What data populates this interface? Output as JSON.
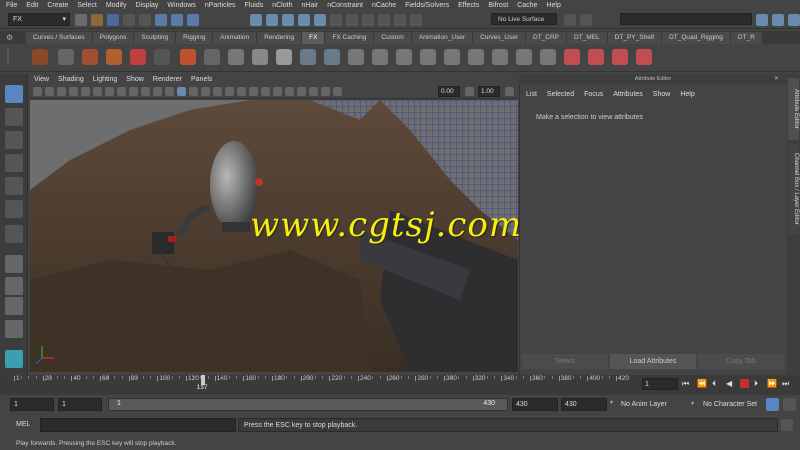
{
  "menubar": [
    "File",
    "Edit",
    "Create",
    "Select",
    "Modify",
    "Display",
    "Windows",
    "nParticles",
    "Fluids",
    "nCloth",
    "nHair",
    "nConstraint",
    "nCache",
    "Fields/Solvers",
    "Effects",
    "Bifrost",
    "Cache",
    "Help"
  ],
  "statusline": {
    "mode": "FX",
    "live_surface": "No Live Surface"
  },
  "shelf_tabs": [
    "Curves / Surfaces",
    "Polygons",
    "Sculpting",
    "Rigging",
    "Animation",
    "Rendering",
    "FX",
    "FX Caching",
    "Custom",
    "Animation_User",
    "Curves_User",
    "DT_CRP",
    "DT_MEL",
    "DT_PY_Shelf",
    "DT_Quad_Rigging",
    "DT_R"
  ],
  "shelf_active": "FX",
  "viewport": {
    "menu": [
      "View",
      "Shading",
      "Lighting",
      "Show",
      "Renderer",
      "Panels"
    ],
    "exposure": "0.00",
    "gamma": "1.00"
  },
  "watermark": "www.cgtsj.com",
  "attribute_editor": {
    "title": "Attribute Editor",
    "menu": [
      "List",
      "Selected",
      "Focus",
      "Attributes",
      "Show",
      "Help"
    ],
    "message": "Make a selection to view attributes",
    "buttons": {
      "select": "Select",
      "load": "Load Attributes",
      "copy": "Copy Tab"
    }
  },
  "side_tabs": {
    "attribute_editor": "Attribute Editor",
    "channel_box": "Channel Box / Layer Editor"
  },
  "timeline": {
    "ticks": [
      "1",
      "20",
      "40",
      "60",
      "80",
      "100",
      "120",
      "140",
      "160",
      "180",
      "200",
      "220",
      "240",
      "260",
      "280",
      "300",
      "320",
      "340",
      "360",
      "380",
      "400",
      "420"
    ],
    "current_frame": "137",
    "current_frame_field": "1",
    "playhead_position": 0.31
  },
  "range": {
    "start": "1",
    "playback_start": "1",
    "slider_start": "1",
    "slider_end": "430",
    "playback_end": "430",
    "end": "430",
    "anim_layer": "No Anim Layer",
    "character_set": "No Character Set"
  },
  "command_line": {
    "label": "MEL",
    "result": "Press the ESC key to stop playback."
  },
  "help_line": "Play forwards. Pressing the ESC key will stop playback."
}
